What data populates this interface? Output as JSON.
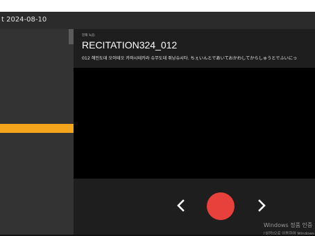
{
  "window": {
    "title": "t 2024-08-10"
  },
  "main": {
    "caption_label": "현재 녹음:",
    "prompt_id": "RECITATION324_012",
    "prompt_text": "012 헤인도데 오이테오 카와시테카라 슈무도데 쥐낭슈시타. ちぇいんとであいておかわしてからしゅうとでふいにっ"
  },
  "controls": {
    "prev_icon": "chevron-left-icon",
    "record_icon": "record-circle-icon",
    "next_icon": "chevron-right-icon",
    "record_color": "#e8403a"
  },
  "watermark": {
    "line1": "Windows 정품 인증",
    "line2": "[설정]으로 이동하여 Windows"
  },
  "colors": {
    "accent": "#f4a51c",
    "sidebar_bg": "#333333",
    "main_bg": "#1e1e1e",
    "titlebar_bg": "#2b2b2b"
  }
}
